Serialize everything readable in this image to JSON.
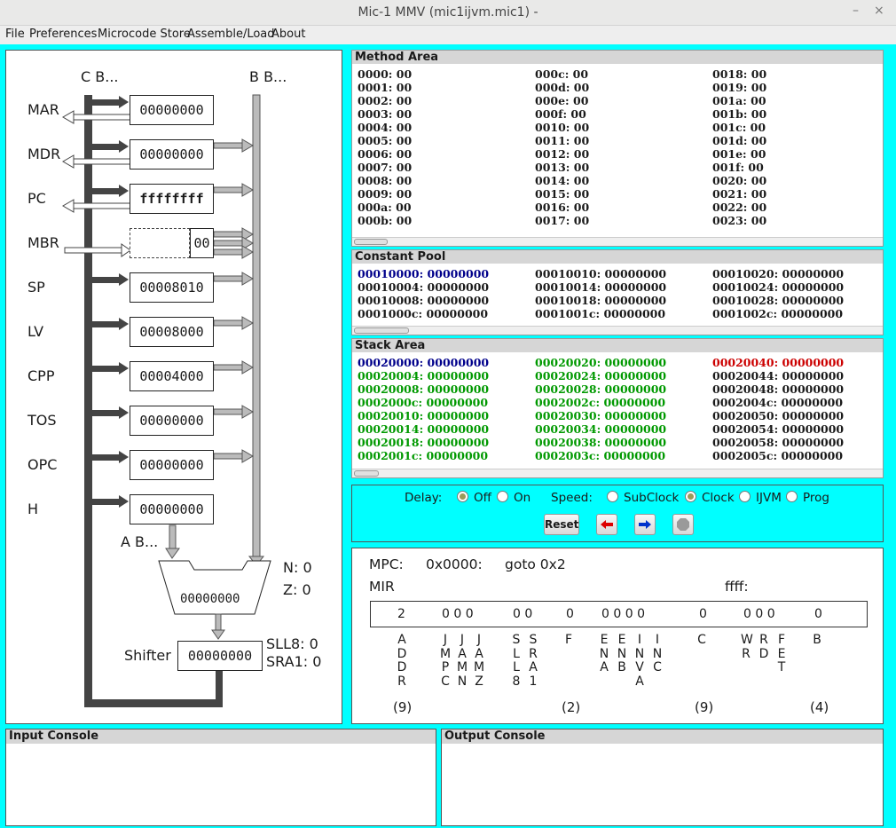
{
  "window": {
    "title": "Mic-1 MMV (mic1ijvm.mic1) -",
    "minimize": "–",
    "close": "×"
  },
  "menu": {
    "file": "File",
    "preferences": "Preferences",
    "microcode_store": "Microcode Store",
    "assemble_load": "Assemble/Load",
    "about": "About"
  },
  "datapath": {
    "c_bus": "C B...",
    "b_bus": "B B...",
    "a_bus": "A B...",
    "registers": [
      {
        "name": "MAR",
        "value": "00000000"
      },
      {
        "name": "MDR",
        "value": "00000000"
      },
      {
        "name": "PC",
        "value": "ffffffff"
      },
      {
        "name": "MBR",
        "value": "00"
      },
      {
        "name": "SP",
        "value": "00008010"
      },
      {
        "name": "LV",
        "value": "00008000"
      },
      {
        "name": "CPP",
        "value": "00004000"
      },
      {
        "name": "TOS",
        "value": "00000000"
      },
      {
        "name": "OPC",
        "value": "00000000"
      },
      {
        "name": "H",
        "value": "00000000"
      }
    ],
    "alu_value": "00000000",
    "n_flag": "N: 0",
    "z_flag": "Z: 0",
    "shifter_label": "Shifter",
    "shifter_value": "00000000",
    "sll8": "SLL8: 0",
    "sra1": "SRA1: 0"
  },
  "method_area": {
    "title": "Method Area",
    "col1": [
      "0000: 00",
      "0001: 00",
      "0002: 00",
      "0003: 00",
      "0004: 00",
      "0005: 00",
      "0006: 00",
      "0007: 00",
      "0008: 00",
      "0009: 00",
      "000a: 00",
      "000b: 00"
    ],
    "col2": [
      "000c: 00",
      "000d: 00",
      "000e: 00",
      "000f: 00",
      "0010: 00",
      "0011: 00",
      "0012: 00",
      "0013: 00",
      "0014: 00",
      "0015: 00",
      "0016: 00",
      "0017: 00"
    ],
    "col3": [
      "0018: 00",
      "0019: 00",
      "001a: 00",
      "001b: 00",
      "001c: 00",
      "001d: 00",
      "001e: 00",
      "001f: 00",
      "0020: 00",
      "0021: 00",
      "0022: 00",
      "0023: 00"
    ]
  },
  "constant_pool": {
    "title": "Constant Pool",
    "col1": [
      "00010000: 00000000",
      "00010004: 00000000",
      "00010008: 00000000",
      "0001000c: 00000000"
    ],
    "col2": [
      "00010010: 00000000",
      "00010014: 00000000",
      "00010018: 00000000",
      "0001001c: 00000000"
    ],
    "col3": [
      "00010020: 00000000",
      "00010024: 00000000",
      "00010028: 00000000",
      "0001002c: 00000000"
    ]
  },
  "stack_area": {
    "title": "Stack Area",
    "col1": [
      "00020000: 00000000",
      "00020004: 00000000",
      "00020008: 00000000",
      "0002000c: 00000000",
      "00020010: 00000000",
      "00020014: 00000000",
      "00020018: 00000000",
      "0002001c: 00000000"
    ],
    "col2": [
      "00020020: 00000000",
      "00020024: 00000000",
      "00020028: 00000000",
      "0002002c: 00000000",
      "00020030: 00000000",
      "00020034: 00000000",
      "00020038: 00000000",
      "0002003c: 00000000"
    ],
    "col3": [
      "00020040: 00000000",
      "00020044: 00000000",
      "00020048: 00000000",
      "0002004c: 00000000",
      "00020050: 00000000",
      "00020054: 00000000",
      "00020058: 00000000",
      "0002005c: 00000000"
    ]
  },
  "colors": {
    "blue": "#00008b",
    "green": "#009900",
    "red": "#cc0000",
    "cyan": "#00ffff"
  },
  "controls": {
    "delay_label": "Delay:",
    "off": "Off",
    "on": "On",
    "speed_label": "Speed:",
    "subclock": "SubClock",
    "clock": "Clock",
    "ijvm": "IJVM",
    "prog": "Prog",
    "reset": "Reset"
  },
  "mpc_panel": {
    "mpc_label": "MPC:",
    "mpc_value": "0x0000:",
    "instruction": "goto 0x2",
    "mir_label": "MIR",
    "next": "ffff:",
    "mir": {
      "addr": "2",
      "jmp": "0 0 0",
      "shift": "0 0",
      "f": "0",
      "ena": "0 0 0 0",
      "c": "0",
      "mem": "0 0 0",
      "b": "0"
    },
    "field_labels": [
      "ADDR",
      "JMPC",
      "JAMN",
      "JAMZ",
      "SLL8",
      "SRA1",
      "F",
      "ENA",
      "ENB",
      "INVA",
      "INC",
      "C",
      "WR",
      "RD",
      "FET",
      "B"
    ],
    "counts": {
      "addr": "(9)",
      "f": "(2)",
      "c": "(9)",
      "b": "(4)"
    }
  },
  "consoles": {
    "input": "Input Console",
    "output": "Output Console"
  }
}
